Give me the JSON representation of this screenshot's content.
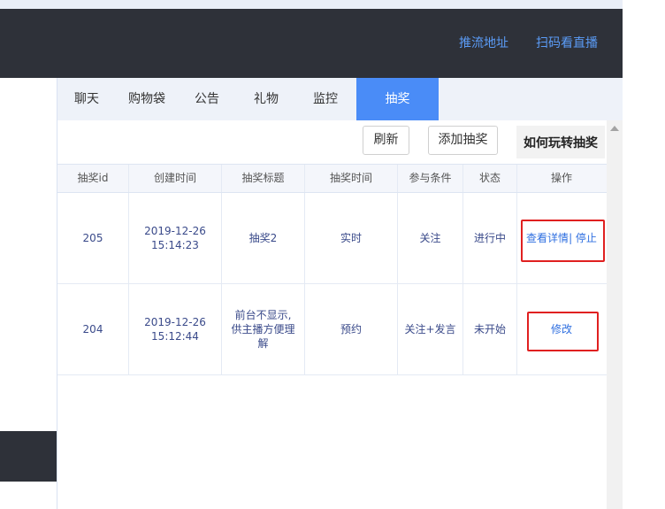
{
  "header": {
    "push_url_label": "推流地址",
    "scan_watch_label": "扫码看直播"
  },
  "tabs": [
    {
      "label": "聊天",
      "active": false
    },
    {
      "label": "购物袋",
      "active": false
    },
    {
      "label": "公告",
      "active": false
    },
    {
      "label": "礼物",
      "active": false
    },
    {
      "label": "监控",
      "active": false
    },
    {
      "label": "抽奖",
      "active": true
    }
  ],
  "toolbar": {
    "refresh_label": "刷新",
    "add_lottery_label": "添加抽奖",
    "howto_label": "如何玩转抽奖"
  },
  "table": {
    "columns": [
      "抽奖id",
      "创建时间",
      "抽奖标题",
      "抽奖时间",
      "参与条件",
      "状态",
      "操作"
    ],
    "rows": [
      {
        "id": "205",
        "created_date": "2019-12-26",
        "created_time": "15:14:23",
        "title_lines": [
          "抽奖2"
        ],
        "lottery_time": "实时",
        "condition": "关注",
        "status": "进行中",
        "actions": [
          "查看详情",
          "停止"
        ]
      },
      {
        "id": "204",
        "created_date": "2019-12-26",
        "created_time": "15:12:44",
        "title_lines": [
          "前台不显示,",
          "供主播方便理",
          "解"
        ],
        "lottery_time": "预约",
        "condition": "关注+发言",
        "status": "未开始",
        "actions": [
          "修改"
        ]
      }
    ]
  },
  "colors": {
    "topbar_bg": "#2e3139",
    "accent": "#4a8cf7",
    "link": "#2f6fe0",
    "highlight": "#e02020"
  }
}
